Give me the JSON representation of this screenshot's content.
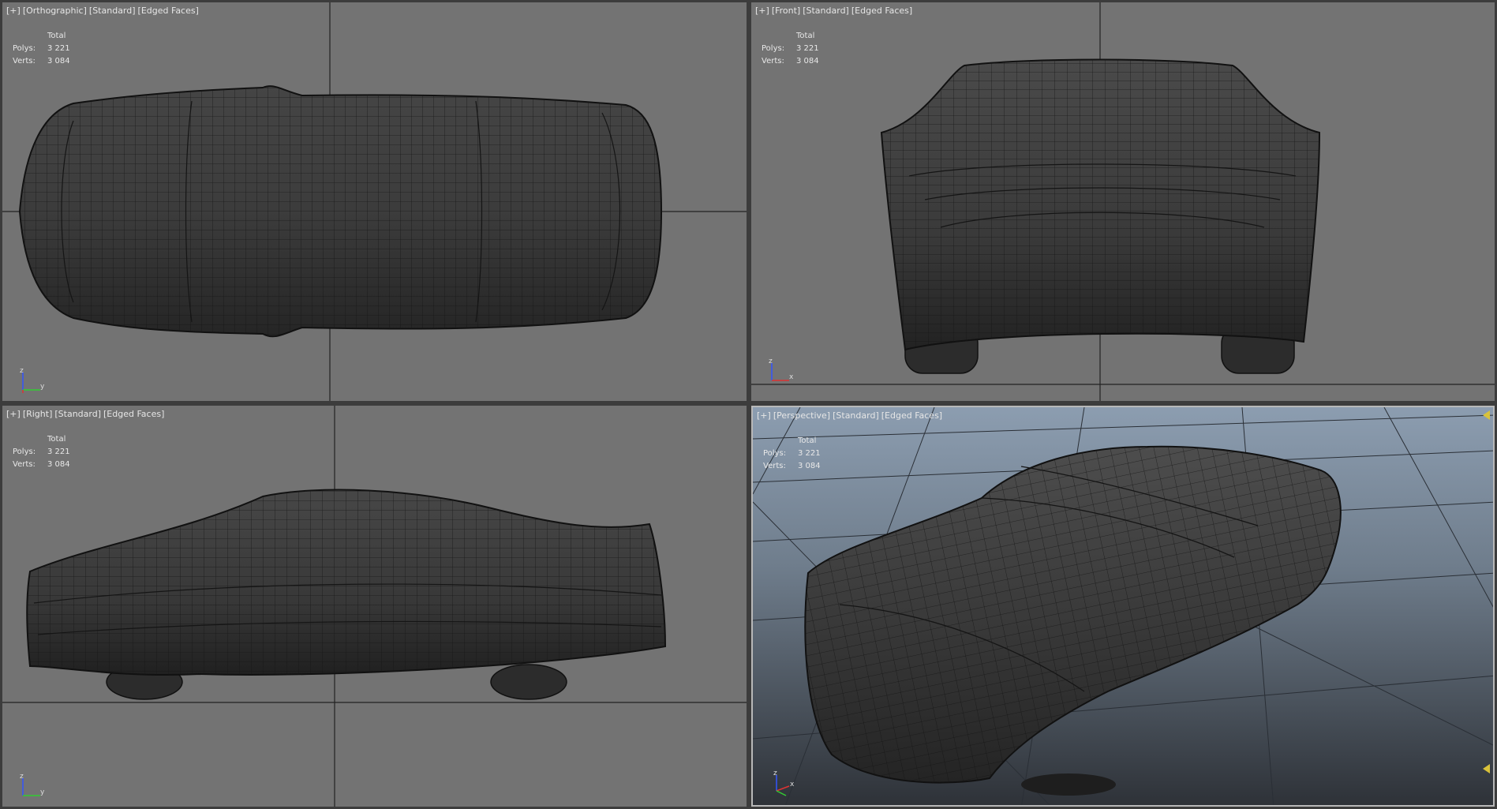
{
  "viewports": [
    {
      "id": "top",
      "label": [
        "[+]",
        "[Orthographic]",
        "[Standard]",
        "[Edged Faces]"
      ],
      "stats": {
        "header": "Total",
        "polys_label": "Polys:",
        "polys": "3 221",
        "verts_label": "Verts:",
        "verts": "3 084"
      },
      "axis": {
        "up": "z",
        "right": "y"
      }
    },
    {
      "id": "front",
      "label": [
        "[+]",
        "[Front]",
        "[Standard]",
        "[Edged Faces]"
      ],
      "stats": {
        "header": "Total",
        "polys_label": "Polys:",
        "polys": "3 221",
        "verts_label": "Verts:",
        "verts": "3 084"
      },
      "axis": {
        "up": "z",
        "right": "x"
      }
    },
    {
      "id": "right",
      "label": [
        "[+]",
        "[Right]",
        "[Standard]",
        "[Edged Faces]"
      ],
      "stats": {
        "header": "Total",
        "polys_label": "Polys:",
        "polys": "3 221",
        "verts_label": "Verts:",
        "verts": "3 084"
      },
      "axis": {
        "up": "z",
        "right": "y"
      }
    },
    {
      "id": "perspective",
      "label": [
        "[+]",
        "[Perspective]",
        "[Standard]",
        "[Edged Faces]"
      ],
      "stats": {
        "header": "Total",
        "polys_label": "Polys:",
        "polys": "3 221",
        "verts_label": "Verts:",
        "verts": "3 084"
      },
      "axis": {
        "up": "z",
        "right": "x"
      }
    }
  ],
  "colors": {
    "viewport_bg": "#737373",
    "mesh_fill": "#3a3a3a",
    "mesh_wire": "#141414",
    "grid_line": "#222222",
    "label_text": "#e6e6e6",
    "axis_x": "#d33",
    "axis_y": "#3c3",
    "axis_z": "#35f"
  }
}
